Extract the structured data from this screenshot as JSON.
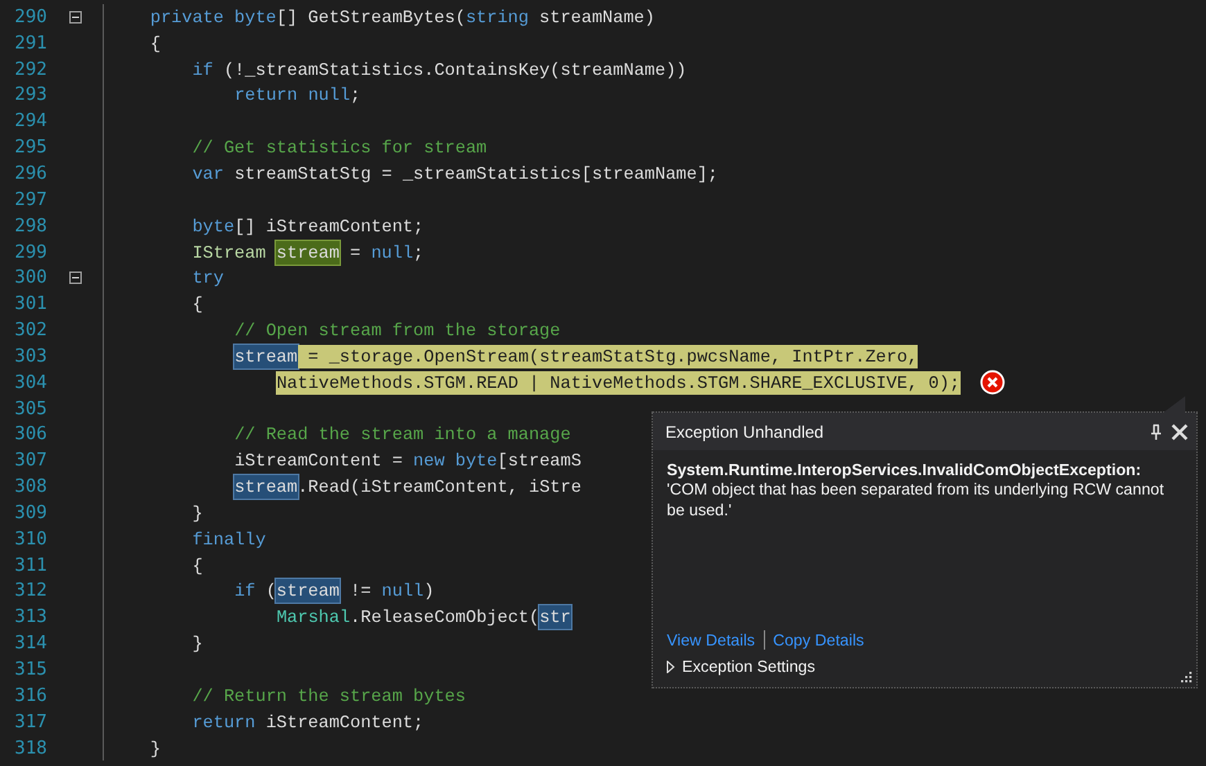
{
  "editor": {
    "lines": [
      {
        "number": "290",
        "fold": true,
        "tokens": [
          {
            "text": "private ",
            "kind": "keyword"
          },
          {
            "text": "byte",
            "kind": "keyword"
          },
          {
            "text": "[] GetStreamBytes("
          },
          {
            "text": "string",
            "kind": "keyword"
          },
          {
            "text": " streamName)"
          }
        ]
      },
      {
        "number": "291",
        "fold": false,
        "tokens": [
          {
            "text": "{"
          }
        ],
        "children": [
          {
            "number": "292",
            "fold": false,
            "tokens": [
              {
                "text": "if",
                "kind": "keyword"
              },
              {
                "text": " (!_streamStatistics.ContainsKey(streamName))"
              }
            ],
            "children": [
              {
                "number": "293",
                "fold": false,
                "tokens": [
                  {
                    "text": "return ",
                    "kind": "keyword"
                  },
                  {
                    "text": "null",
                    "kind": "keyword"
                  },
                  {
                    "text": ";"
                  }
                ]
              }
            ]
          },
          {
            "number": "294",
            "fold": false
          },
          {
            "number": "295",
            "fold": false,
            "tokens": [
              {
                "text": "// Get statistics for stream",
                "kind": "comment"
              }
            ]
          },
          {
            "number": "296",
            "fold": false,
            "tokens": [
              {
                "text": "var",
                "kind": "keyword"
              },
              {
                "text": " streamStatStg = _streamStatistics[streamName];"
              }
            ]
          },
          {
            "number": "297",
            "fold": false
          },
          {
            "number": "298",
            "fold": false,
            "tokens": [
              {
                "text": "byte",
                "kind": "keyword"
              },
              {
                "text": "[] iStreamContent;"
              }
            ]
          },
          {
            "number": "299",
            "fold": false,
            "tokens": [
              {
                "text": "IStream ",
                "kind": "interface"
              },
              {
                "text": "stream",
                "kind": "definition"
              },
              {
                "text": " = "
              },
              {
                "text": "null",
                "kind": "keyword"
              },
              {
                "text": ";"
              }
            ]
          },
          {
            "number": "300",
            "fold": true,
            "tokens": [
              {
                "text": "try",
                "kind": "keyword"
              }
            ]
          },
          {
            "number": "301",
            "fold": false,
            "tokens": [
              {
                "text": "{"
              }
            ],
            "children": [
              {
                "number": "302",
                "fold": false,
                "tokens": [
                  {
                    "text": "// Open stream from the storage",
                    "kind": "comment"
                  }
                ]
              },
              {
                "number": "303",
                "fold": false,
                "tokens": [
                  {
                    "text": "stream",
                    "kind": "reference",
                    "current": true
                  },
                  {
                    "text": " = _storage.OpenStream(streamStatStg.pwcsName, IntPtr.Zero,",
                    "current": true
                  }
                ],
                "children": [
                  {
                    "number": "304",
                    "fold": false,
                    "error": true,
                    "tokens": [
                      {
                        "text": "NativeMethods.STGM.READ | NativeMethods.STGM.SHARE_EXCLUSIVE, 0);",
                        "current": true
                      }
                    ]
                  }
                ]
              },
              {
                "number": "305",
                "fold": false
              },
              {
                "number": "306",
                "fold": false,
                "tokens": [
                  {
                    "text": "// Read the stream into a manage",
                    "kind": "comment"
                  }
                ]
              },
              {
                "number": "307",
                "fold": false,
                "tokens": [
                  {
                    "text": "iStreamContent = "
                  },
                  {
                    "text": "new ",
                    "kind": "keyword"
                  },
                  {
                    "text": "byte",
                    "kind": "keyword"
                  },
                  {
                    "text": "[streamS"
                  }
                ]
              },
              {
                "number": "308",
                "fold": false,
                "tokens": [
                  {
                    "text": "stream",
                    "kind": "reference"
                  },
                  {
                    "text": ".Read(iStreamContent, iStre"
                  }
                ]
              }
            ]
          },
          {
            "number": "309",
            "fold": false,
            "tokens": [
              {
                "text": "}"
              }
            ]
          },
          {
            "number": "310",
            "fold": false,
            "tokens": [
              {
                "text": "finally",
                "kind": "keyword"
              }
            ]
          },
          {
            "number": "311",
            "fold": false,
            "tokens": [
              {
                "text": "{"
              }
            ],
            "children": [
              {
                "number": "312",
                "fold": false,
                "tokens": [
                  {
                    "text": "if",
                    "kind": "keyword"
                  },
                  {
                    "text": " ("
                  },
                  {
                    "text": "stream",
                    "kind": "reference"
                  },
                  {
                    "text": " != "
                  },
                  {
                    "text": "null",
                    "kind": "keyword"
                  },
                  {
                    "text": ")"
                  }
                ],
                "children": [
                  {
                    "number": "313",
                    "fold": false,
                    "tokens": [
                      {
                        "text": "Marshal",
                        "kind": "type"
                      },
                      {
                        "text": ".ReleaseComObject("
                      },
                      {
                        "text": "str",
                        "kind": "reference"
                      }
                    ]
                  }
                ]
              }
            ]
          },
          {
            "number": "314",
            "fold": false,
            "tokens": [
              {
                "text": "}"
              }
            ]
          },
          {
            "number": "315",
            "fold": false
          },
          {
            "number": "316",
            "fold": false,
            "tokens": [
              {
                "text": "// Return the stream bytes",
                "kind": "comment"
              }
            ]
          },
          {
            "number": "317",
            "fold": false,
            "tokens": [
              {
                "text": "return",
                "kind": "keyword"
              },
              {
                "text": " iStreamContent;"
              }
            ]
          }
        ]
      },
      {
        "number": "318",
        "fold": false,
        "tokens": [
          {
            "text": "}"
          }
        ]
      }
    ]
  },
  "exception_popup": {
    "title": "Exception Unhandled",
    "exception_type": "System.Runtime.InteropServices.InvalidComObjectException:",
    "message": "'COM object that has been separated from its underlying RCW cannot be used.'",
    "links": [
      "View Details",
      "Copy Details"
    ],
    "settings": {
      "label": "Exception Settings",
      "expanded": false
    }
  }
}
